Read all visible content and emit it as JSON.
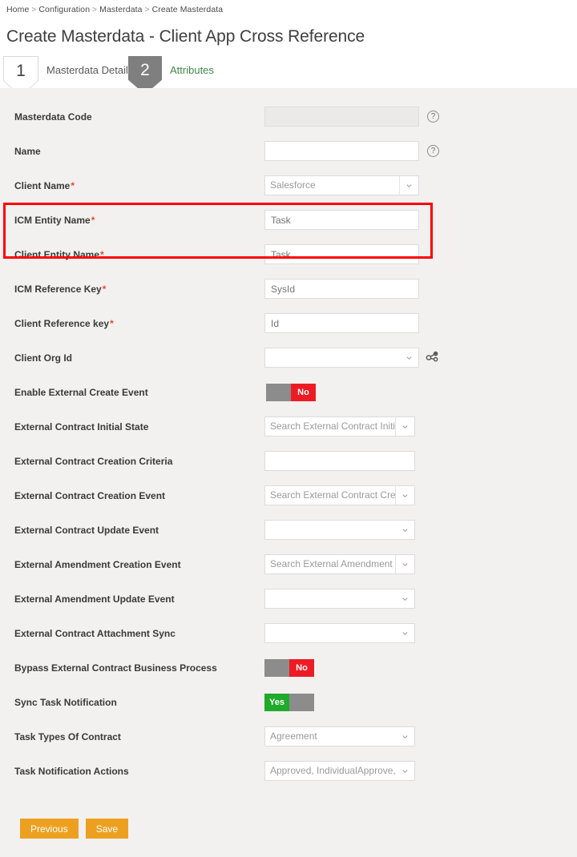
{
  "breadcrumb": {
    "items": [
      "Home",
      "Configuration",
      "Masterdata",
      "Create Masterdata"
    ],
    "separator": ">"
  },
  "page_title": "Create Masterdata - Client App Cross Reference",
  "steps": [
    {
      "number": "1",
      "label": "Masterdata Details",
      "active": false
    },
    {
      "number": "2",
      "label": "Attributes",
      "active": true
    }
  ],
  "colors": {
    "background": "#f2f1ef",
    "accent_button": "#eda020",
    "toggle_off": "#ed1c24",
    "toggle_on": "#1faa2b",
    "highlight": "#ff0000",
    "active_step_text": "#3d8b4b",
    "required_marker": "#e8492f"
  },
  "highlight": {
    "note": "red outline around ICM Entity Name and Client Entity Name rows"
  },
  "form": {
    "fields": [
      {
        "label": "Masterdata Code",
        "required": false,
        "type": "text",
        "value": "",
        "placeholder": "",
        "disabled": true,
        "help": "?"
      },
      {
        "label": "Name",
        "required": false,
        "type": "text",
        "value": "",
        "placeholder": "",
        "disabled": false,
        "help": "?"
      },
      {
        "label": "Client Name",
        "required": true,
        "type": "select",
        "value": "Salesforce"
      },
      {
        "label": "ICM Entity Name",
        "required": true,
        "type": "text",
        "value": "",
        "placeholder": "Task",
        "disabled": false
      },
      {
        "label": "Client Entity Name",
        "required": true,
        "type": "text",
        "value": "",
        "placeholder": "Task",
        "disabled": false
      },
      {
        "label": "ICM Reference Key",
        "required": true,
        "type": "text",
        "value": "",
        "placeholder": "SysId",
        "disabled": false
      },
      {
        "label": "Client Reference key",
        "required": true,
        "type": "text",
        "value": "",
        "placeholder": "Id",
        "disabled": false
      },
      {
        "label": "Client Org Id",
        "required": false,
        "type": "select",
        "value": "",
        "icon": "node-link-icon"
      },
      {
        "label": "Enable External Create Event",
        "required": false,
        "type": "toggle",
        "value": "No",
        "on": false
      },
      {
        "label": "External Contract Initial State",
        "required": false,
        "type": "select",
        "value": "Search External Contract Initial S"
      },
      {
        "label": "External Contract Creation Criteria",
        "required": false,
        "type": "text",
        "value": "",
        "placeholder": "",
        "disabled": false
      },
      {
        "label": "External Contract Creation Event",
        "required": false,
        "type": "select",
        "value": "Search External Contract Creation"
      },
      {
        "label": "External Contract Update Event",
        "required": false,
        "type": "select",
        "value": ""
      },
      {
        "label": "External Amendment Creation Event",
        "required": false,
        "type": "select",
        "value": "Search External Amendment Cre"
      },
      {
        "label": "External Amendment Update Event",
        "required": false,
        "type": "select",
        "value": ""
      },
      {
        "label": "External Contract Attachment Sync",
        "required": false,
        "type": "select",
        "value": ""
      },
      {
        "label": "Bypass External Contract Business Process",
        "required": false,
        "type": "toggle",
        "value": "No",
        "on": false
      },
      {
        "label": "Sync Task Notification",
        "required": false,
        "type": "toggle",
        "value": "Yes",
        "on": true
      },
      {
        "label": "Task Types Of Contract",
        "required": false,
        "type": "select",
        "value": "Agreement"
      },
      {
        "label": "Task Notification Actions",
        "required": false,
        "type": "select",
        "value": "Approved, IndividualApprove, I..."
      }
    ]
  },
  "actions": {
    "previous_label": "Previous",
    "save_label": "Save"
  }
}
